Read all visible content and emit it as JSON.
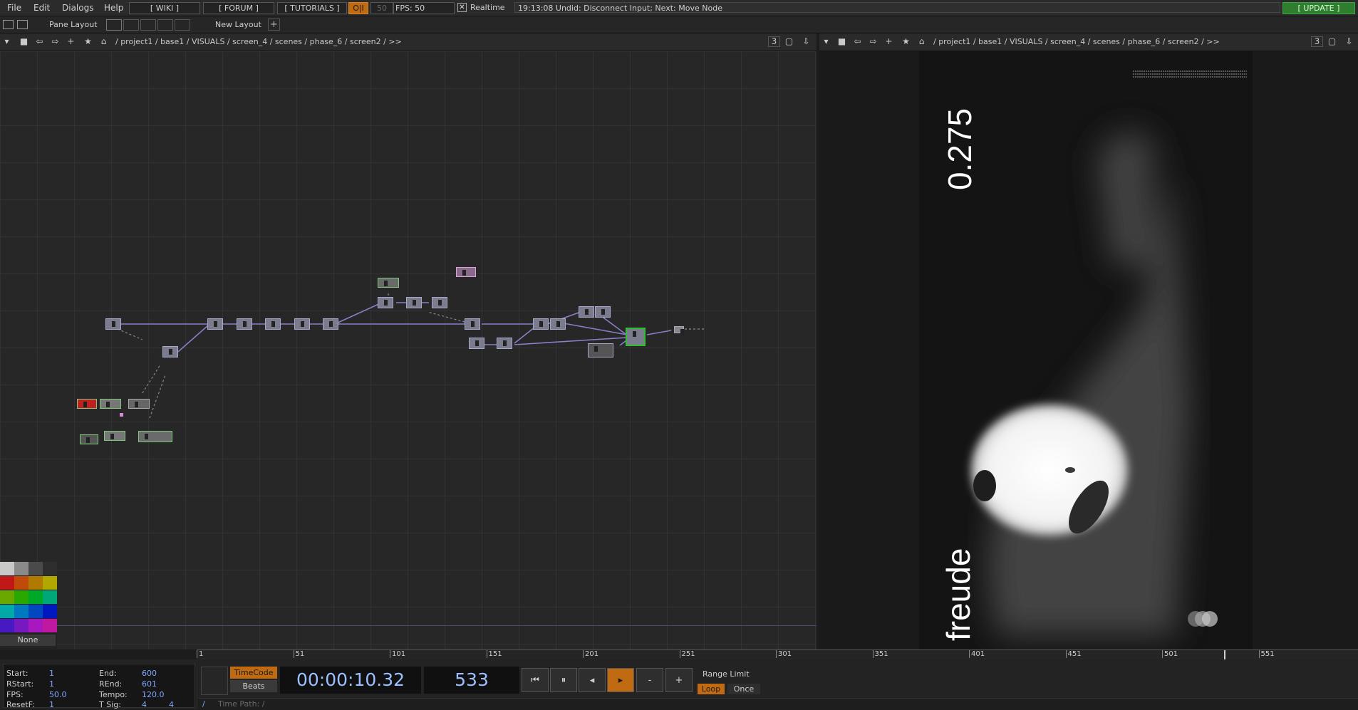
{
  "menu": {
    "file": "File",
    "edit": "Edit",
    "dialogs": "Dialogs",
    "help": "Help",
    "wiki": "[ WIKI ]",
    "forum": "[ FORUM ]",
    "tutorials": "[ TUTORIALS ]",
    "oi": "O|I",
    "fps_target": "50",
    "fps_label": "FPS:",
    "fps_value": "50",
    "realtime_label": "Realtime",
    "status_message": "19:13:08 Undid: Disconnect Input; Next: Move Node",
    "update": "[ UPDATE ]"
  },
  "layoutbar": {
    "pane_layout": "Pane Layout",
    "new_layout": "New Layout",
    "plus": "+"
  },
  "left_pane": {
    "path": "/ project1 / base1 / VISUALS / screen_4 / scenes / phase_6 / screen2 / >>",
    "pane_num": "3"
  },
  "right_pane": {
    "path": "/ project1 / base1 / VISUALS / screen_4 / scenes / phase_6 / screen2 / >>",
    "pane_num": "3"
  },
  "viewer": {
    "value_text": "0.275",
    "word_text": "freude"
  },
  "palette": {
    "none_label": "None",
    "colors": [
      "#c8c8c8",
      "#8a8a8a",
      "#4a4a4a",
      "#2e2e2e",
      "#c01818",
      "#c04a0a",
      "#b07a00",
      "#b0a800",
      "#6aa800",
      "#28a800",
      "#00a828",
      "#00a878",
      "#00a8a8",
      "#0078c0",
      "#0048c0",
      "#0018c0",
      "#4818c0",
      "#7818c0",
      "#a818c0",
      "#c018a0"
    ]
  },
  "timeline": {
    "ticks": [
      "1",
      "51",
      "101",
      "151",
      "201",
      "251",
      "301",
      "351",
      "401",
      "451",
      "501",
      "551"
    ]
  },
  "info": {
    "start_label": "Start:",
    "start": "1",
    "end_label": "End:",
    "end": "600",
    "rstart_label": "RStart:",
    "rstart": "1",
    "rend_label": "REnd:",
    "rend": "601",
    "fps_label": "FPS:",
    "fps": "50.0",
    "tempo_label": "Tempo:",
    "tempo": "120.0",
    "resetf_label": "ResetF:",
    "resetf": "1",
    "tsig_label": "T Sig:",
    "tsig_a": "4",
    "tsig_b": "4"
  },
  "transport": {
    "timecode_label": "TimeCode",
    "beats_label": "Beats",
    "timecode": "00:00:10.32",
    "frame": "533",
    "minus": "-",
    "plus": "+",
    "range_limit": "Range Limit",
    "loop": "Loop",
    "once": "Once",
    "time_path": "Time Path: /",
    "slash": "/"
  }
}
